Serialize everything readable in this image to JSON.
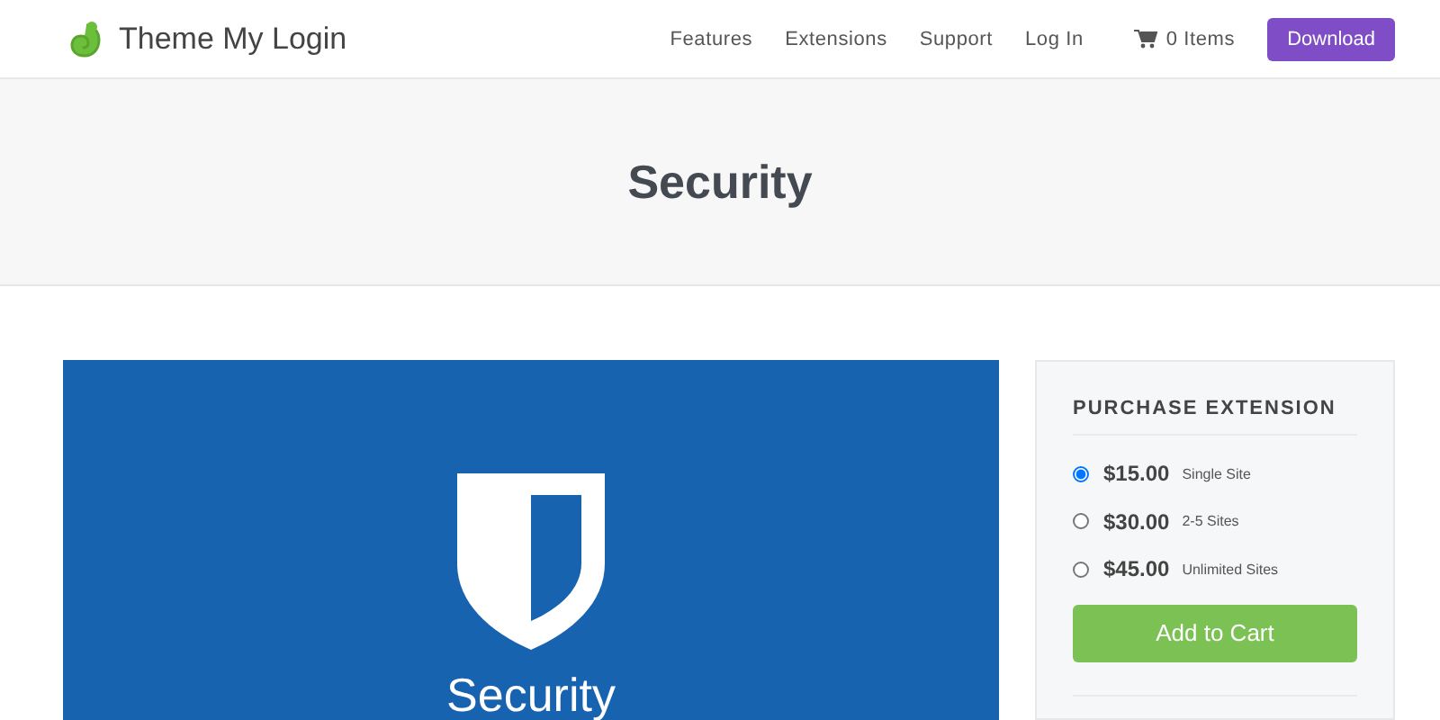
{
  "header": {
    "brand": "Theme My Login",
    "nav": [
      {
        "label": "Features"
      },
      {
        "label": "Extensions"
      },
      {
        "label": "Support"
      },
      {
        "label": "Log In"
      }
    ],
    "cart": "0 Items",
    "download": "Download"
  },
  "hero": {
    "title": "Security"
  },
  "banner": {
    "title": "Security"
  },
  "purchase": {
    "heading": "PURCHASE EXTENSION",
    "options": [
      {
        "price": "$15.00",
        "label": "Single Site",
        "selected": true
      },
      {
        "price": "$30.00",
        "label": "2-5 Sites",
        "selected": false
      },
      {
        "price": "$45.00",
        "label": "Unlimited Sites",
        "selected": false
      }
    ],
    "button": "Add to Cart"
  }
}
